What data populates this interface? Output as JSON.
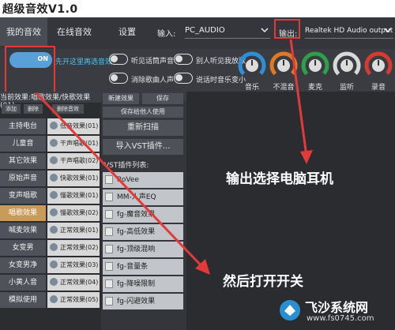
{
  "app": {
    "title": "超级音效V1.0"
  },
  "tabs": [
    {
      "label": "我的音效",
      "active": true
    },
    {
      "label": "在线音效",
      "active": false
    },
    {
      "label": "设置",
      "active": false
    }
  ],
  "io": {
    "input_label": "输入:",
    "input_value": "PC_AUDIO",
    "output_label": "输出:",
    "output_value": "Realtek HD Audio output"
  },
  "main_toggle": {
    "on_label": "ON",
    "caption": "先开这里再选音效"
  },
  "options": [
    {
      "label": "听见话筒声音"
    },
    {
      "label": "别人听见我放歌"
    },
    {
      "label": "消除歌曲人声"
    },
    {
      "label": "说话时音乐变小"
    }
  ],
  "knobs": [
    {
      "label": "音乐",
      "color": "#2f8fd6"
    },
    {
      "label": "不混音",
      "color": "#e07a22"
    },
    {
      "label": "麦克",
      "color": "#2e9f4a"
    },
    {
      "label": "监听",
      "color": "#d9d9d9"
    },
    {
      "label": "录音",
      "color": "#d93a2f"
    }
  ],
  "left": {
    "section_title": "当前效果:唱歌效果/快歌效果(01)",
    "buttons": [
      "添加",
      "删除",
      "删除音效"
    ],
    "presets": [
      "主持电台",
      "儿童音",
      "其它效果",
      "原始声音",
      "变声唱歌",
      "唱歌效果",
      "喊麦效果",
      "女变男",
      "女变男净",
      "小黄人音",
      "模拟使用"
    ],
    "selected_preset": "唱歌效果",
    "effects": [
      "低音效果(01)",
      "干声唱歌(01)",
      "干声唱歌(02)",
      "快歌效果(01)",
      "慢歌效果(01)",
      "慢歌效果(02)",
      "正常效果(01)",
      "正常效果(02)",
      "正常效果(03)",
      "正常效果(04)",
      "正常效果(05)"
    ]
  },
  "middle": {
    "new_effect": "新建效果",
    "save": "保存",
    "save_for_others": "保存给他人使用",
    "rescan": "重新扫描",
    "import_vst": "导入VST插件...",
    "vst_list_title": "VST插件列表:",
    "vst_items": [
      "RoVee",
      "MM-人声EQ",
      "fg-魔音效果",
      "fg-高低效果",
      "fg-顶级混响",
      "fg-音量条",
      "fg-降噪限制",
      "fg-闪避效果"
    ]
  },
  "annotations": {
    "output_tip": "输出选择电脑耳机",
    "toggle_tip": "然后打开开关",
    "arrow_color": "#e23a3a"
  },
  "watermark": {
    "name": "飞沙系统网",
    "url": "www.fs0745.com"
  }
}
